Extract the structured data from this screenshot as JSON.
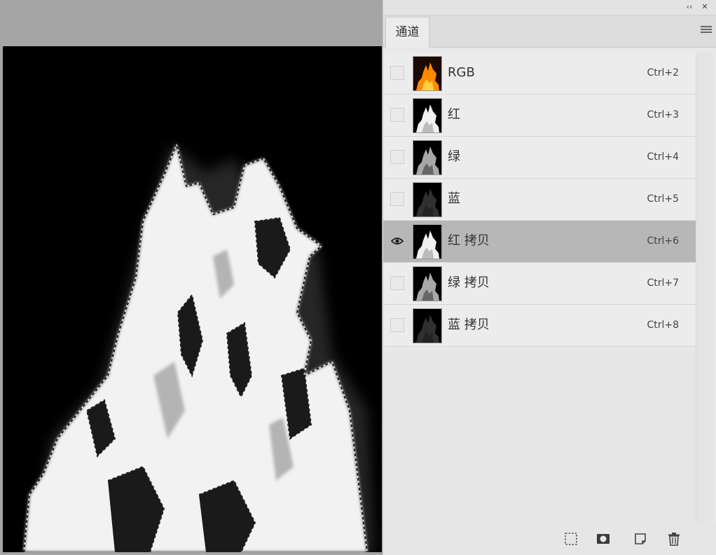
{
  "panel": {
    "tab_label": "通道",
    "collapse_glyph": "‹‹",
    "close_glyph": "✕"
  },
  "channels": [
    {
      "name": "RGB",
      "shortcut": "Ctrl+2",
      "visible": false,
      "selected": false,
      "thumb": "color"
    },
    {
      "name": "红",
      "shortcut": "Ctrl+3",
      "visible": false,
      "selected": false,
      "thumb": "bright"
    },
    {
      "name": "绿",
      "shortcut": "Ctrl+4",
      "visible": false,
      "selected": false,
      "thumb": "mid"
    },
    {
      "name": "蓝",
      "shortcut": "Ctrl+5",
      "visible": false,
      "selected": false,
      "thumb": "dark"
    },
    {
      "name": "红 拷贝",
      "shortcut": "Ctrl+6",
      "visible": true,
      "selected": true,
      "thumb": "bright"
    },
    {
      "name": "绿 拷贝",
      "shortcut": "Ctrl+7",
      "visible": false,
      "selected": false,
      "thumb": "mid"
    },
    {
      "name": "蓝 拷贝",
      "shortcut": "Ctrl+8",
      "visible": false,
      "selected": false,
      "thumb": "dark"
    }
  ],
  "colors": {
    "panel_bg": "#e8e8e8",
    "row_selected": "#b7b7b7",
    "canvas_bg": "#000000",
    "workspace_bg": "#a5a5a5"
  },
  "icons": {
    "footer": [
      "selection-from-channel-icon",
      "save-selection-icon",
      "new-channel-icon",
      "delete-channel-icon"
    ]
  }
}
